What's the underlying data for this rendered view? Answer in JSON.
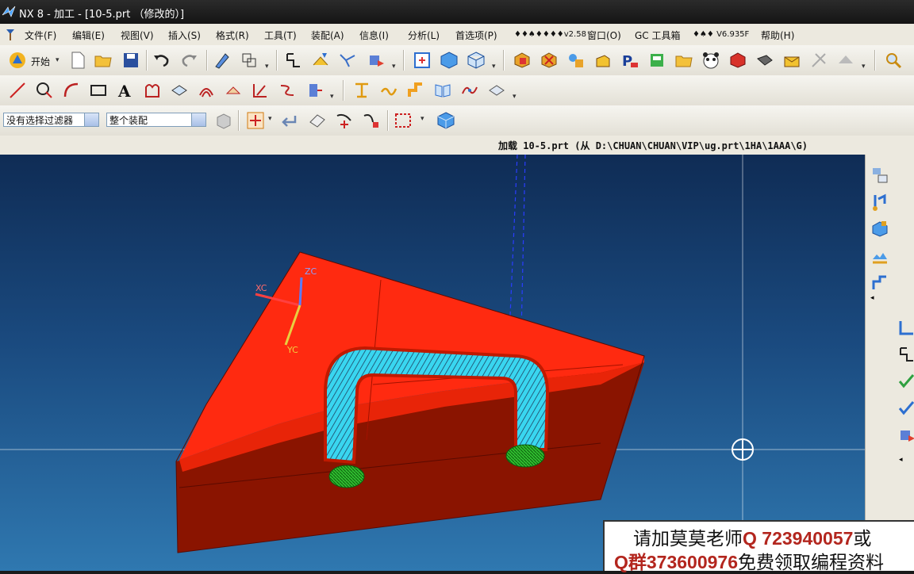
{
  "window": {
    "title": "NX 8 - 加工 - [10-5.prt （修改的）]"
  },
  "menu": {
    "items": [
      "文件(F)",
      "编辑(E)",
      "视图(V)",
      "插入(S)",
      "格式(R)",
      "工具(T)",
      "装配(A)",
      "信息(I)",
      "分析(L)",
      "首选项(P)",
      "♦♦♠♦♦♦♦v2.58",
      "窗口(O)",
      "GC 工具箱",
      "♦♠♦ V6.935F",
      "帮助(H)"
    ]
  },
  "toolbar": {
    "start_label": "开始",
    "filter_select": "没有选择过滤器",
    "assembly_select": "整个装配"
  },
  "status": {
    "text": "加载 10-5.prt (从 D:\\CHUAN\\CHUAN\\VIP\\ug.prt\\1HA\\1AAA\\G)"
  },
  "viewport": {
    "wcs_labels": {
      "xc": "XC",
      "yc": "YC",
      "zc": "ZC"
    },
    "colors": {
      "part": "#ff2a10",
      "toolpath": "#39d6f0",
      "ends": "#2fbf2f"
    }
  },
  "watermark": {
    "line1_prefix": "请加莫莫老师",
    "line1_q": "Q 723940057",
    "line1_suffix": "或",
    "line2_prefix": "Q群",
    "line2_q": "373600976",
    "line2_suffix": "免费领取编程资料"
  }
}
